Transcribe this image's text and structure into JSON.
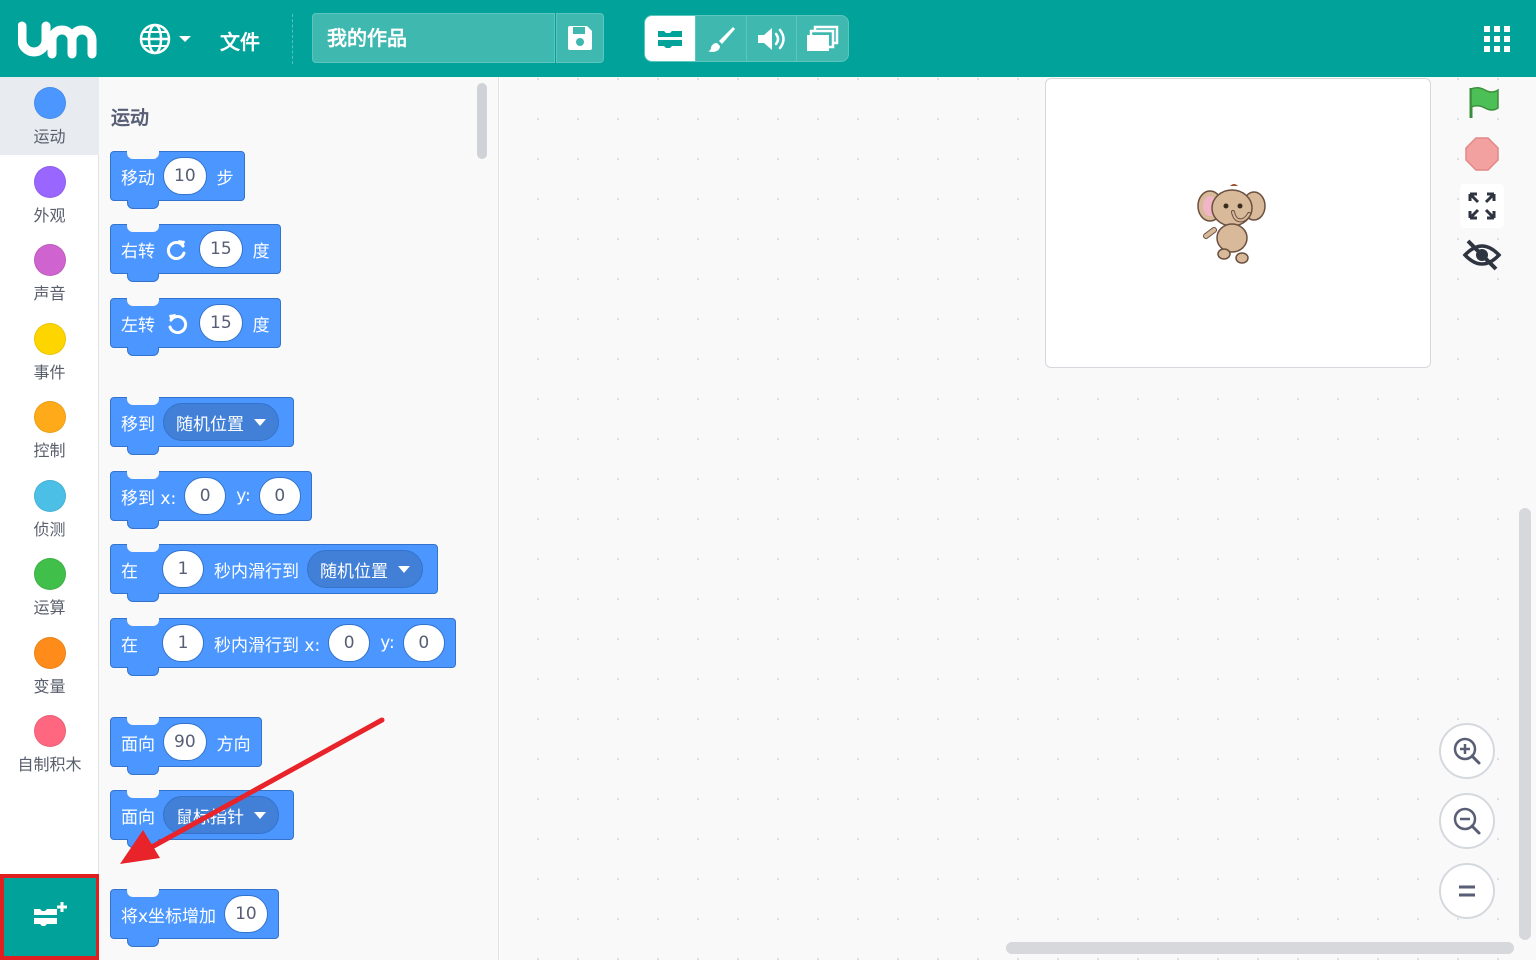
{
  "header": {
    "file_menu": "文件",
    "project_title": "我的作品"
  },
  "categories": [
    {
      "label": "运动",
      "color": "#4c97ff"
    },
    {
      "label": "外观",
      "color": "#9966ff"
    },
    {
      "label": "声音",
      "color": "#cf63cf"
    },
    {
      "label": "事件",
      "color": "#ffd500"
    },
    {
      "label": "控制",
      "color": "#ffab19"
    },
    {
      "label": "侦测",
      "color": "#4cbfe6"
    },
    {
      "label": "运算",
      "color": "#40bf4a"
    },
    {
      "label": "变量",
      "color": "#ff8c1a"
    },
    {
      "label": "自制积木",
      "color": "#ff6680"
    }
  ],
  "palette": {
    "section_title": "运动",
    "blocks": {
      "move": {
        "text1": "移动",
        "value": "10",
        "text2": "步"
      },
      "turn_right": {
        "text1": "右转",
        "value": "15",
        "text2": "度"
      },
      "turn_left": {
        "text1": "左转",
        "value": "15",
        "text2": "度"
      },
      "goto": {
        "text1": "移到",
        "option": "随机位置"
      },
      "goto_xy": {
        "text1": "移到 x:",
        "x": "0",
        "ylabel": "y:",
        "y": "0"
      },
      "glide": {
        "text1": "在",
        "secs": "1",
        "text2": "秒内滑行到",
        "option": "随机位置"
      },
      "glide_xy": {
        "text1": "在",
        "secs": "1",
        "text2": "秒内滑行到 x:",
        "x": "0",
        "ylabel": "y:",
        "y": "0"
      },
      "point_dir": {
        "text1": "面向",
        "value": "90",
        "text2": "方向"
      },
      "point_towards": {
        "text1": "面向",
        "option": "鼠标指针"
      },
      "change_x": {
        "text1": "将x坐标增加",
        "value": "10"
      }
    }
  },
  "colors": {
    "brand": "#00a29a",
    "motion": "#4c97ff",
    "highlight": "#e02020"
  },
  "icons": {
    "logo": "um-logo",
    "language": "globe-icon",
    "save": "floppy-icon",
    "code_tab": "code-blocks-icon",
    "costume_tab": "paintbrush-icon",
    "sound_tab": "speaker-icon",
    "layers": "layers-icon",
    "apps": "grid-icon",
    "green_flag": "green-flag-icon",
    "stop": "stop-icon",
    "fullscreen": "fullscreen-icon",
    "hide": "eye-slash-icon",
    "zoom_in": "zoom-in-icon",
    "zoom_out": "zoom-out-icon",
    "zoom_reset": "zoom-reset-icon",
    "add_extension": "add-extension-icon"
  }
}
